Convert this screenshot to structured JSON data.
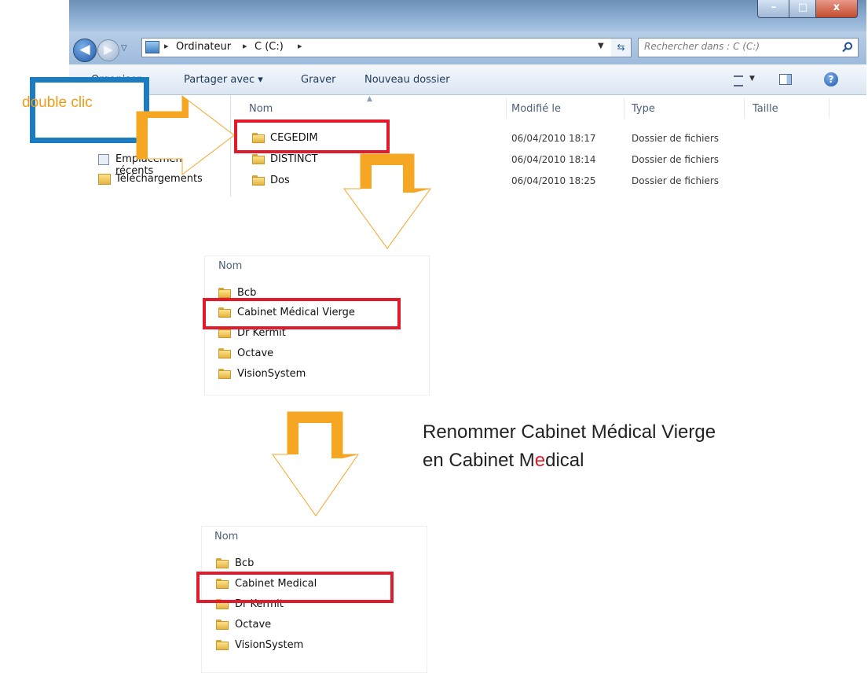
{
  "window": {
    "minimize_glyph": "–",
    "maximize_glyph": "□",
    "close_glyph": "x"
  },
  "breadcrumb": {
    "items": [
      "Ordinateur",
      "C (C:)"
    ],
    "separator": "▸"
  },
  "search": {
    "placeholder": "Rechercher dans : C (C:)"
  },
  "toolbar": {
    "organize_label": "Organiser",
    "share_label": "Partager avec ▾",
    "burn_label": "Graver",
    "new_folder_label": "Nouveau dossier"
  },
  "navpane": {
    "items": [
      "Emplacements récents",
      "Téléchargements"
    ]
  },
  "columns": {
    "name": "Nom",
    "modified": "Modifié le",
    "type": "Type",
    "size": "Taille"
  },
  "files": [
    {
      "name": "CEGEDIM",
      "date": "06/04/2010 18:17",
      "type": "Dossier de fichiers"
    },
    {
      "name": "DISTINCT",
      "date": "06/04/2010 18:14",
      "type": "Dossier de fichiers"
    },
    {
      "name": "Dos",
      "date": "06/04/2010 18:25",
      "type": "Dossier de fichiers"
    }
  ],
  "annotation": {
    "double_click_label": "double clic",
    "instruction_line1": "Renommer Cabinet Médical Vierge",
    "instruction_line2_a": "en Cabinet M",
    "instruction_line2_highlight": "e",
    "instruction_line2_b": "dical"
  },
  "panel_before": {
    "header": "Nom",
    "items": [
      "Bcb",
      "Cabinet Médical Vierge",
      "Dr Kermit",
      "Octave",
      "VisionSystem"
    ]
  },
  "panel_after": {
    "header": "Nom",
    "items": [
      "Bcb",
      "Cabinet Medical",
      "Dr Kermit",
      "Octave",
      "VisionSystem"
    ]
  },
  "colors": {
    "highlight_red": "#e21b2c",
    "arrow_orange": "#f5a623",
    "callout_blue": "#1d7bbf",
    "label_orange": "#f39c12"
  }
}
